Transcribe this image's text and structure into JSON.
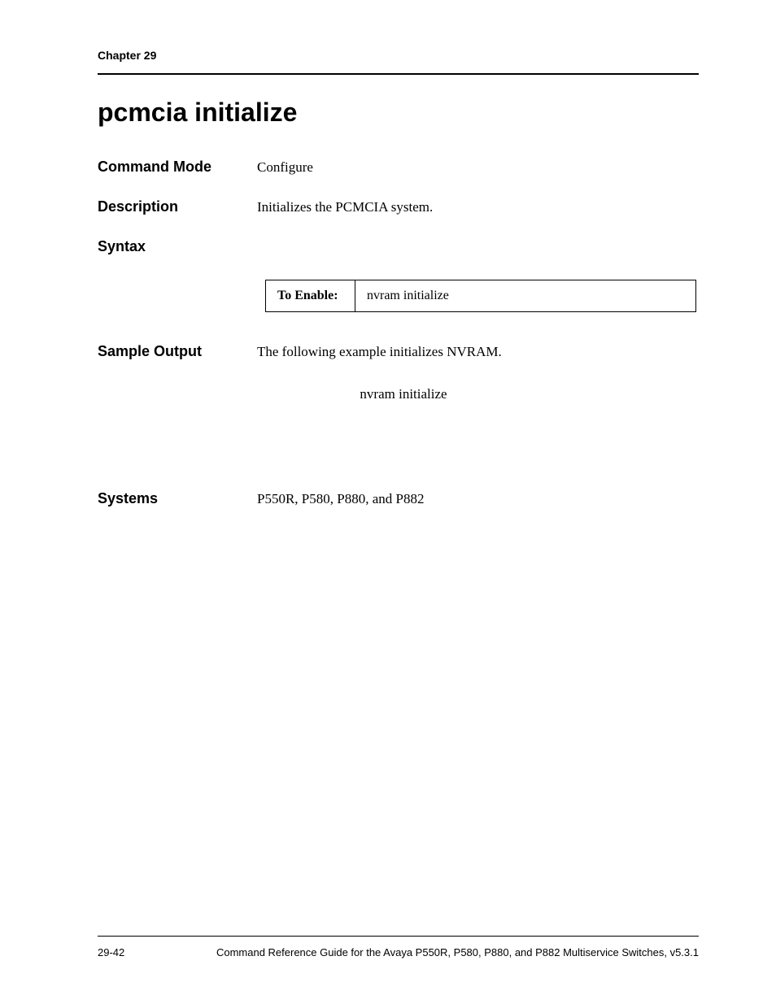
{
  "header": {
    "chapter": "Chapter 29"
  },
  "title": "pcmcia initialize",
  "sections": {
    "command_mode": {
      "label": "Command Mode",
      "value": "Configure"
    },
    "description": {
      "label": "Description",
      "value": "Initializes the PCMCIA system."
    },
    "syntax": {
      "label": "Syntax",
      "table": {
        "header": "To Enable:",
        "command": "nvram initialize"
      }
    },
    "sample_output": {
      "label": "Sample Output",
      "value": "The following example initializes NVRAM.",
      "command": "nvram initialize"
    },
    "systems": {
      "label": "Systems",
      "value": "P550R, P580, P880, and P882"
    }
  },
  "footer": {
    "page_number": "29-42",
    "guide_text": "Command Reference Guide for the Avaya P550R, P580, P880, and P882 Multiservice Switches, v5.3.1"
  }
}
